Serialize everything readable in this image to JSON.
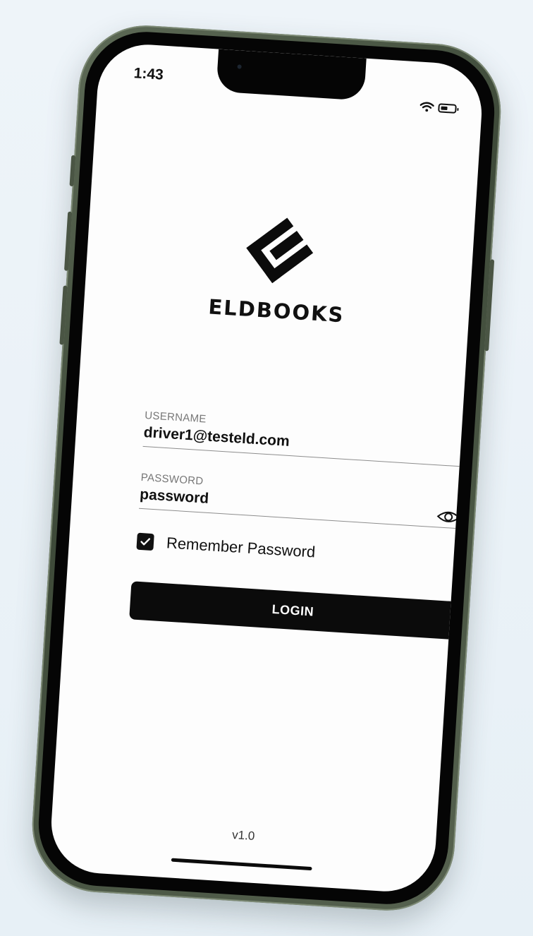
{
  "status_bar": {
    "time": "1:43",
    "wifi_icon": "wifi-icon",
    "battery_icon": "battery-icon"
  },
  "brand": {
    "logo_icon": "eldbooks-logo-icon",
    "name": "ELDBOOKS"
  },
  "form": {
    "username": {
      "label": "USERNAME",
      "value": "driver1@testeld.com"
    },
    "password": {
      "label": "PASSWORD",
      "value": "password",
      "toggle_icon": "eye-icon"
    },
    "remember": {
      "label": "Remember Password",
      "checked": true
    },
    "login_label": "LOGIN"
  },
  "footer": {
    "version": "v1.0"
  },
  "colors": {
    "primary": "#0b0b0b",
    "background": "#fdfdfd",
    "frame": "#4a5645"
  }
}
